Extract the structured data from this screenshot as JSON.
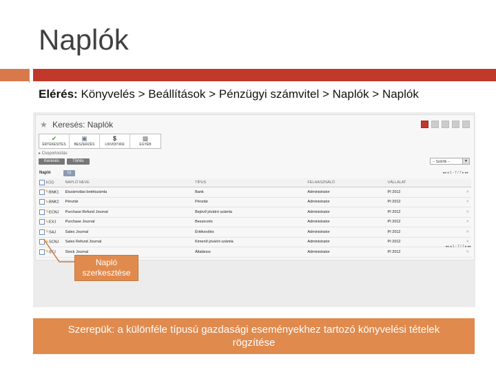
{
  "slide": {
    "title": "Naplók",
    "breadcrumb_label": "Elérés:",
    "breadcrumb_path": "Könyvelés > Beállítások > Pénzügyi számvitel > Naplók > Naplók"
  },
  "app": {
    "search_title": "Keresés: Naplók",
    "categories": [
      {
        "label": "ÉRTÉKESÍTÉS",
        "icon": "checkmark-icon"
      },
      {
        "label": "BESZERZÉS",
        "icon": "cart-icon"
      },
      {
        "label": "LIKVIDITÁSI",
        "icon": "dollar-icon"
      },
      {
        "label": "EGYÉB",
        "icon": "box-icon"
      }
    ],
    "group_label": "Csoportosítás",
    "search_button": "Keresés",
    "clear_button": "Törlés",
    "filter_select": "-- Szűrők --",
    "table_label": "Napló",
    "new_button": "Új",
    "pager_text": "1 - 7 / 7",
    "columns": [
      "KÓD",
      "NAPLÓ NEVE",
      "TÍPUS",
      "FELHASZNÁLÓ",
      "VÁLLALAT"
    ],
    "rows": [
      {
        "code": "BNK1",
        "name": "Elszámolási betétszámla",
        "type": "Bank",
        "user": "Administrator",
        "company": "PI 2012"
      },
      {
        "code": "BNK2",
        "name": "Pénztár",
        "type": "Pénztár",
        "user": "Administrator",
        "company": "PI 2012"
      },
      {
        "code": "ECNJ",
        "name": "Purchase Refund Journal",
        "type": "Bejövő jóváíró számla",
        "user": "Administrator",
        "company": "PI 2012"
      },
      {
        "code": "EXJ",
        "name": "Purchase Journal",
        "type": "Beszerzés",
        "user": "Administrator",
        "company": "PI 2012"
      },
      {
        "code": "SAJ",
        "name": "Sales Journal",
        "type": "Értékesítés",
        "user": "Administrator",
        "company": "PI 2012"
      },
      {
        "code": "SCNJ",
        "name": "Sales Refund Journal",
        "type": "Kimenő jóváíró számla",
        "user": "Administrator",
        "company": "PI 2012"
      },
      {
        "code": "STJ",
        "name": "Stock Journal",
        "type": "Általános",
        "user": "Administrator",
        "company": "PI 2012"
      }
    ]
  },
  "callout": {
    "line1": "Napló",
    "line2": "szerkesztése"
  },
  "caption": "Szerepük: a különféle típusú gazdasági eseményekhez tartozó könyvelési tételek rögzítése",
  "colors": {
    "accent": "#c0392b",
    "orange": "#e08a4d",
    "title": "#404040"
  }
}
